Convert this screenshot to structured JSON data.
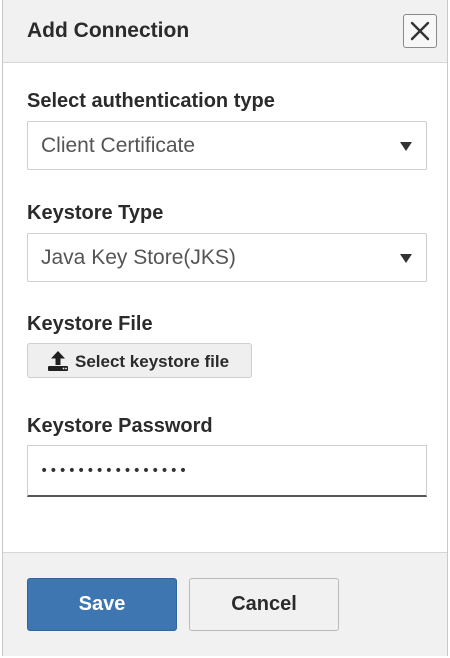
{
  "dialog": {
    "title": "Add Connection",
    "close_icon": "close-icon"
  },
  "form": {
    "auth_type": {
      "label": "Select authentication type",
      "value": "Client Certificate"
    },
    "keystore_type": {
      "label": "Keystore Type",
      "value": "Java Key Store(JKS)"
    },
    "keystore_file": {
      "label": "Keystore File",
      "button_label": "Select keystore file",
      "icon": "upload-icon"
    },
    "keystore_password": {
      "label": "Keystore Password",
      "value": "••••••••••••••••"
    }
  },
  "footer": {
    "save_label": "Save",
    "cancel_label": "Cancel"
  },
  "colors": {
    "primary": "#3d76b0",
    "header_bg": "#f1f1f1"
  }
}
